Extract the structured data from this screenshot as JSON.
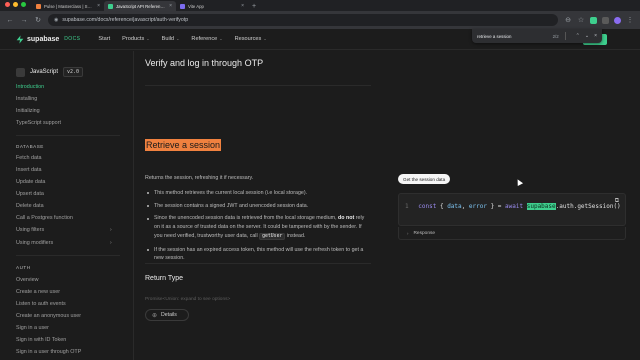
{
  "browser": {
    "tabs": [
      {
        "label": "Pulse | Masterclass | Supabase",
        "favicon_color": "#f0813f",
        "active": false
      },
      {
        "label": "JavaScript API Reference | Supabase",
        "favicon_color": "#3ecf8e",
        "active": true
      },
      {
        "label": "Vite App",
        "favicon_color": "#7c6cf0",
        "active": false
      }
    ],
    "url": "supabase.com/docs/reference/javascript/auth-verifyotp",
    "find": {
      "query": "retrieve a session",
      "count": "2/2"
    }
  },
  "header": {
    "logo_text": "supabase",
    "docs_badge": "DOCS",
    "nav": [
      {
        "label": "Start",
        "has_menu": false
      },
      {
        "label": "Products",
        "has_menu": true
      },
      {
        "label": "Build",
        "has_menu": true
      },
      {
        "label": "Reference",
        "has_menu": true
      },
      {
        "label": "Resources",
        "has_menu": true
      }
    ],
    "button_label": "oard"
  },
  "sidebar": {
    "language": "JavaScript",
    "version": "v2.0",
    "intro_items": [
      "Introduction",
      "Installing",
      "Initializing",
      "TypeScript support"
    ],
    "database_heading": "DATABASE",
    "database_items": [
      "Fetch data",
      "Insert data",
      "Update data",
      "Upsert data",
      "Delete data",
      "Call a Postgres function",
      "Using filters",
      "Using modifiers"
    ],
    "auth_heading": "AUTH",
    "auth_items": [
      "Overview",
      "Create a new user",
      "Listen to auth events",
      "Create an anonymous user",
      "Sign in a user",
      "Sign in with ID Token",
      "Sign in a user through OTP"
    ]
  },
  "main": {
    "page_title": "Verify and log in through OTP",
    "section_title": "Retrieve a session",
    "description": "Returns the session, refreshing it if necessary.",
    "bullets": {
      "b1": "This method retrieves the current local session (i.e local storage).",
      "b2": "The session contains a signed JWT and unencoded session data.",
      "b3_a": "Since the unencoded session data is retrieved from the local storage medium,",
      "b3_bold_1": "do",
      "b3_bold_2": "not",
      "b3_b": "rely on it as a source of trusted data on the server. It could be tampered with by the sender. If you need verified, trustworthy user data, call",
      "b3_code": "getUser",
      "b3_c": "instead.",
      "b4": "If the session has an expired access token, this method will use the refresh token to get a new session."
    },
    "return_type_title": "Return Type",
    "return_type_text": "Promise<Union: expand to see options>",
    "details_label": "Details",
    "code": {
      "tab_label": "Get the session data",
      "line_number": "1",
      "kw_const": "const",
      "open_brace": "{",
      "var_data": "data",
      "comma": ",",
      "var_error": "error",
      "close_eq": "} =",
      "kw_await": "await",
      "highlight": "supabase",
      "rest": ".auth.getSession()",
      "response_label": "Response"
    }
  },
  "colors": {
    "brand": "#3ecf8e",
    "find_highlight": "#f0813f",
    "background": "#1c1c1c"
  }
}
